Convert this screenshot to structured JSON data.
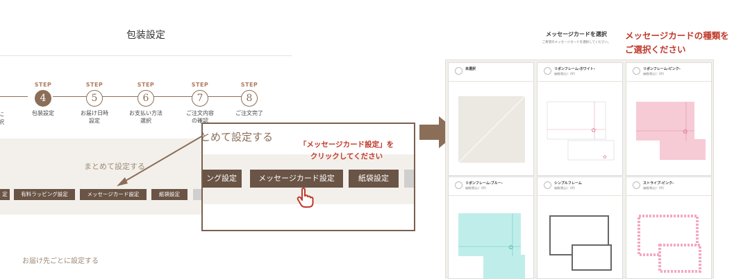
{
  "left": {
    "title": "包装設定",
    "partial_step": "に\n択",
    "steps": [
      {
        "label": "STEP",
        "num": "4",
        "desc": "包装設定",
        "active": true
      },
      {
        "label": "STEP",
        "num": "5",
        "desc": "お届け日時\n設定",
        "active": false
      },
      {
        "label": "STEP",
        "num": "6",
        "desc": "お支払い方法\n選択",
        "active": false
      },
      {
        "label": "STEP",
        "num": "7",
        "desc": "ご注文内容\nの確認",
        "active": false
      },
      {
        "label": "STEP",
        "num": "8",
        "desc": "ご注文完了",
        "active": false
      }
    ],
    "bulk_title": "まとめて設定する",
    "buttons": {
      "cut": "定",
      "paid_wrap": "有料ラッピング設定",
      "message_card": "メッセージカード設定",
      "bag": "紙袋設定"
    },
    "per_delivery": "お届け先ごとに設定する"
  },
  "zoom": {
    "title": "とめて設定する",
    "callout_line1": "「メッセージカード設定」を",
    "callout_line2": "クリックしてください",
    "buttons": {
      "wrap_cut": "ング設定",
      "message_card": "メッセージカード設定",
      "bag": "紙袋設定"
    }
  },
  "modal": {
    "title": "メッセージカードを選択",
    "subtitle": "ご希望のメッセージカードを選択してください。",
    "callout_line1": "メッセージカードの種類を",
    "callout_line2": "ご選択ください",
    "cards": [
      {
        "name": "未選択",
        "price": ""
      },
      {
        "name": "リボンフレーム-ホワイト-",
        "price": "価格(税込)：0円"
      },
      {
        "name": "リボンフレーム-ピンク-",
        "price": "価格(税込)：0円"
      },
      {
        "name": "リボンフレーム-ブルー-",
        "price": "価格(税込)：0円"
      },
      {
        "name": "シンプルフレーム",
        "price": "価格(税込)：0円"
      },
      {
        "name": "ストライプ-ピンク-",
        "price": "価格(税込)：0円"
      }
    ]
  },
  "colors": {
    "accent": "#6a5445",
    "callout": "#c0392b",
    "step": "#8b6e58"
  }
}
